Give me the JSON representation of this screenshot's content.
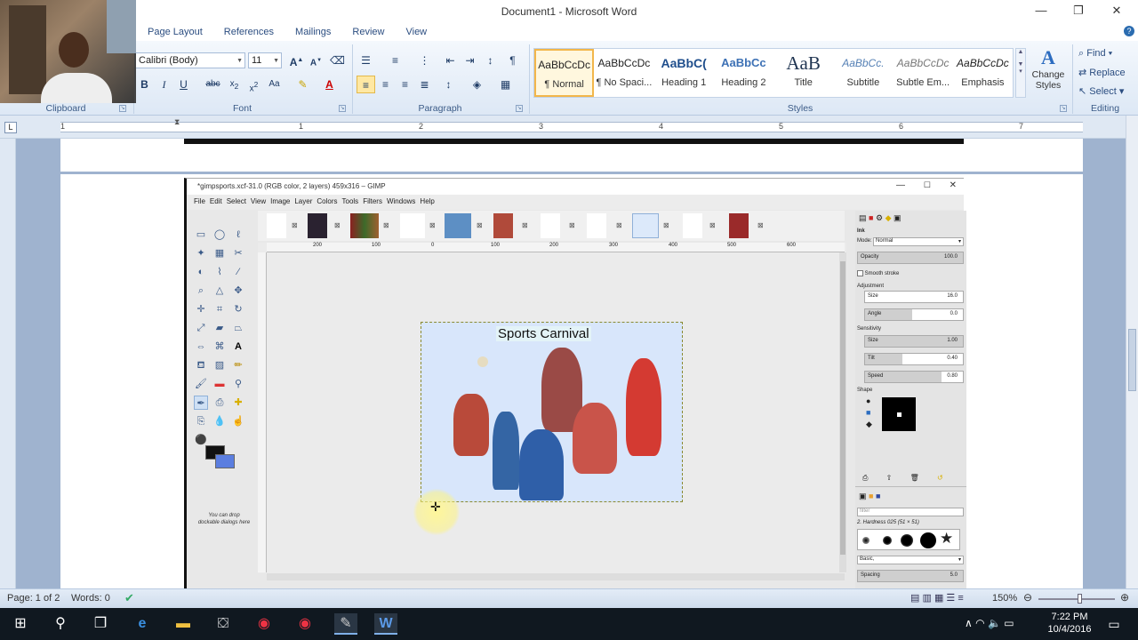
{
  "word": {
    "title": "Document1 - Microsoft Word",
    "tabs": [
      "Page Layout",
      "References",
      "Mailings",
      "Review",
      "View"
    ],
    "groups": {
      "clipboard": "Clipboard",
      "font": "Font",
      "paragraph": "Paragraph",
      "styles": "Styles",
      "editing": "Editing"
    },
    "font_name": "Calibri (Body)",
    "font_size": "11",
    "styles": [
      {
        "sample": "AaBbCcDc",
        "name": "¶ Normal"
      },
      {
        "sample": "AaBbCcDc",
        "name": "¶ No Spaci..."
      },
      {
        "sample": "AaBbC(",
        "name": "Heading 1"
      },
      {
        "sample": "AaBbCc",
        "name": "Heading 2"
      },
      {
        "sample": "AaB",
        "name": "Title"
      },
      {
        "sample": "AaBbCc.",
        "name": "Subtitle"
      },
      {
        "sample": "AaBbCcDc",
        "name": "Subtle Em..."
      },
      {
        "sample": "AaBbCcDc",
        "name": "Emphasis"
      }
    ],
    "change_styles": "Change Styles",
    "editing": {
      "find": "Find",
      "replace": "Replace",
      "select": "Select"
    },
    "ruler_numbers": [
      "1",
      "1",
      "2",
      "3",
      "4",
      "5",
      "6",
      "7"
    ],
    "status": {
      "page": "Page: 1 of 2",
      "words": "Words: 0",
      "zoom": "150%"
    }
  },
  "gimp": {
    "title": "*gimpsports.xcf-31.0 (RGB color, 2 layers) 459x316 – GIMP",
    "menu": [
      "File",
      "Edit",
      "Select",
      "View",
      "Image",
      "Layer",
      "Colors",
      "Tools",
      "Filters",
      "Windows",
      "Help"
    ],
    "image_title": "Sports Carnival",
    "dock_hint": "You can drop dockable dialogs here",
    "ruler_labels": [
      "200",
      "100",
      "0",
      "100",
      "200",
      "300",
      "400",
      "500",
      "600"
    ],
    "tool_options": {
      "heading": "Ink",
      "mode_label": "Mode:",
      "mode_value": "Normal",
      "opacity_label": "Opacity",
      "opacity_value": "100.0",
      "smooth_label": "Smooth stroke",
      "adjustment": "Adjustment",
      "size_label": "Size",
      "size_value": "16.0",
      "angle_label": "Angle",
      "angle_value": "0.0",
      "sensitivity": "Sensitivity",
      "sens_size_label": "Size",
      "sens_size_value": "1.00",
      "tilt_label": "Tilt",
      "tilt_value": "0.40",
      "speed_label": "Speed",
      "speed_value": "0.80",
      "shape": "Shape"
    },
    "brushes": {
      "filter_placeholder": "filter",
      "brush_name": "2. Hardness 025 (51 × 51)",
      "preset": "Basic,",
      "spacing_label": "Spacing",
      "spacing_value": "5.0"
    }
  },
  "taskbar": {
    "time": "7:22 PM",
    "date": "10/4/2016"
  }
}
